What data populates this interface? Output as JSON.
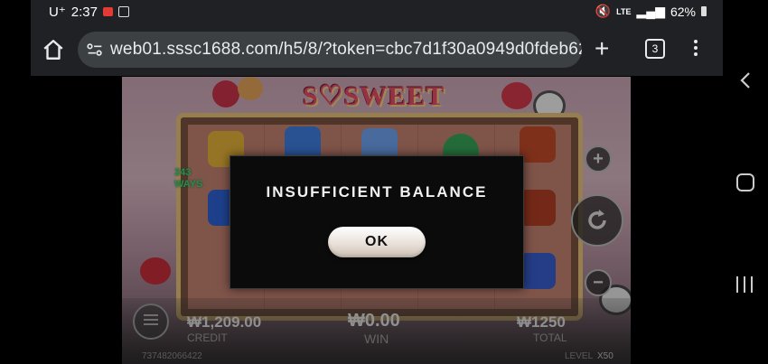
{
  "status_bar": {
    "carrier": "U⁺",
    "time": "2:37",
    "network": "LTE",
    "battery": "62%"
  },
  "browser": {
    "url": "web01.sssc1688.com/h5/8/?token=cbc7d1f30a0949d0fdeb622",
    "tab_count": "3",
    "new_tab_label": "+"
  },
  "game": {
    "logo": "S♡SWEET",
    "ways_text": "243 WAYS",
    "credit_value": "₩1,209.00",
    "credit_label": "CREDIT",
    "win_value": "₩0.00",
    "win_label": "WIN",
    "total_value": "₩1250",
    "total_label": "TOTAL",
    "session_id": "737482066422",
    "level_label": "LEVEL",
    "level_value": "X50",
    "plus_label": "+",
    "minus_label": "−"
  },
  "dialog": {
    "message": "INSUFFICIENT BALANCE",
    "ok_label": "OK"
  },
  "colors": {
    "accent_win": "#dcdcdc",
    "ways_green": "#4ed07a",
    "logo_pink": "#e84c6a"
  }
}
